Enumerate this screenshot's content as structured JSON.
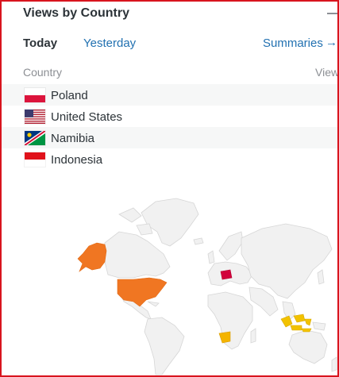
{
  "panel": {
    "title": "Views by Country",
    "tabs": [
      {
        "label": "Today",
        "active": true
      },
      {
        "label": "Yesterday",
        "active": false
      }
    ],
    "summaries_link": "Summaries",
    "summaries_arrow": "→"
  },
  "table": {
    "headers": [
      "Country",
      "Views"
    ],
    "rows": [
      {
        "country": "Poland",
        "flag": "flag-poland-icon"
      },
      {
        "country": "United States",
        "flag": "flag-united-states-icon"
      },
      {
        "country": "Namibia",
        "flag": "flag-namibia-icon"
      },
      {
        "country": "Indonesia",
        "flag": "flag-indonesia-icon"
      }
    ]
  },
  "colors": {
    "link": "#2271b1",
    "frame": "#d8141e",
    "map_land": "#f0f0f0",
    "map_border": "#d6d6d6",
    "high_views": "#f07622",
    "poland": "#d2003b",
    "namibia": "#f4b400",
    "indonesia": "#f2c200"
  }
}
